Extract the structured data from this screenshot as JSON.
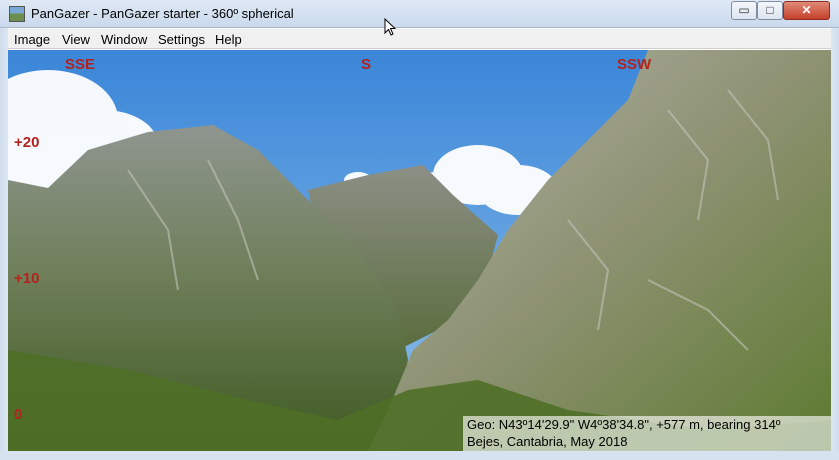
{
  "window": {
    "title": "PanGazer - PanGazer starter - 360º spherical",
    "min_glyph": "▭",
    "max_glyph": "□",
    "close_glyph": "✕"
  },
  "menu": [
    "Image",
    "View",
    "Window",
    "Settings",
    "Help"
  ],
  "panorama": {
    "compass": [
      "SSE",
      "S",
      "SSW"
    ],
    "elevation": [
      "+20",
      "+10",
      "0"
    ],
    "info": {
      "line1": "Geo: N43º14'29.9\" W4º38'34.8\", +577 m, bearing 314º",
      "line2": "Bejes, Cantabria, May 2018"
    }
  },
  "colors": {
    "overlay_label": "#b3231c",
    "sky": "#4a8fd6",
    "rock": "#9a9a94",
    "vegetation": "#5f7d36"
  },
  "icons": [
    "app-icon",
    "minimize-icon",
    "maximize-icon",
    "close-icon",
    "mouse-cursor-icon"
  ]
}
